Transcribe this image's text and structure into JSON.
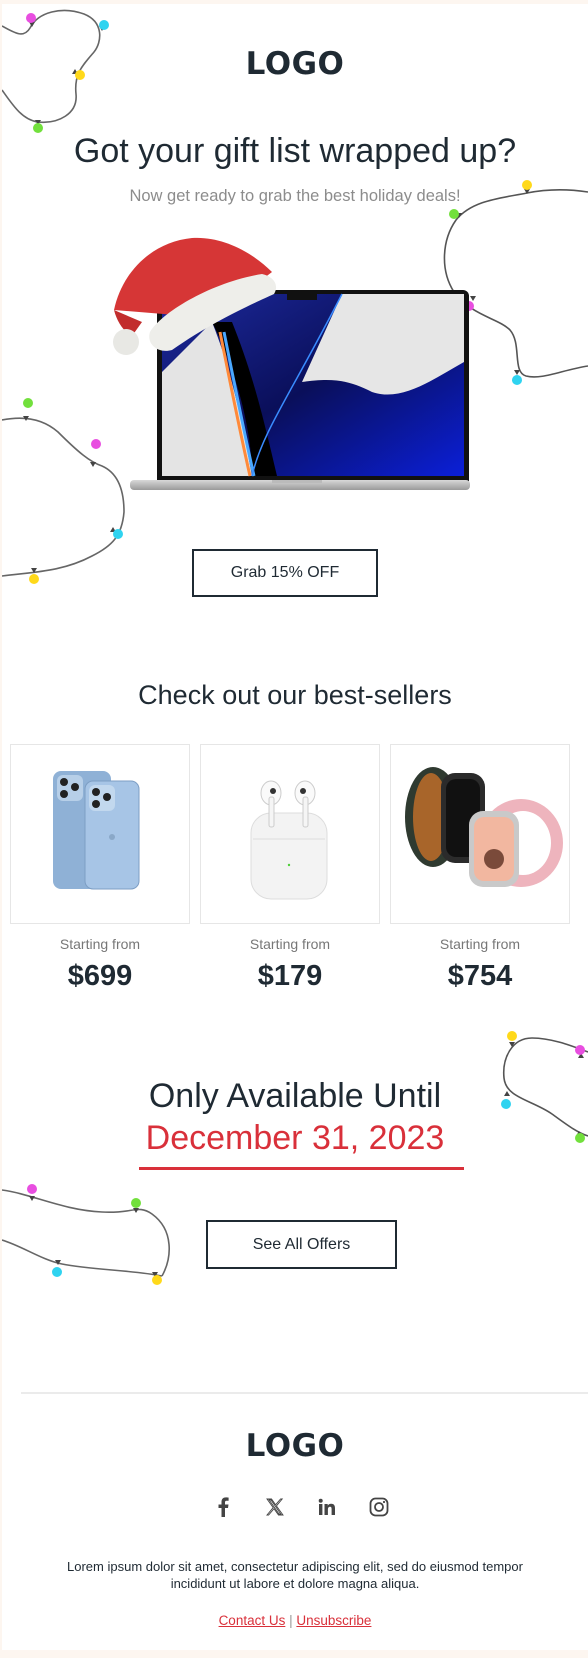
{
  "header": {
    "logo": "LOGO",
    "headline": "Got your gift list wrapped up?",
    "subheadline": "Now get ready to grab the best holiday deals!"
  },
  "hero": {
    "image": "laptop-with-santa-hat",
    "cta_label": "Grab 15% OFF"
  },
  "bestsellers": {
    "title": "Check out our best-sellers",
    "products": [
      {
        "image": "smartphone-blue",
        "caption": "Starting from",
        "price": "$699"
      },
      {
        "image": "wireless-earbuds",
        "caption": "Starting from",
        "price": "$179"
      },
      {
        "image": "smartwatch",
        "caption": "Starting from",
        "price": "$754"
      }
    ]
  },
  "deadline": {
    "line1": "Only Available Until",
    "date": "December 31, 2023",
    "cta_label": "See All Offers"
  },
  "footer": {
    "logo": "LOGO",
    "social": [
      "facebook",
      "x-twitter",
      "linkedin",
      "instagram"
    ],
    "text": "Lorem ipsum dolor sit amet, consectetur adipiscing elit, sed do eiusmod tempor incididunt ut labore et dolore magna aliqua.",
    "contact_label": "Contact Us",
    "separator": "|",
    "unsubscribe_label": "Unsubscribe"
  },
  "colors": {
    "text": "#1f2a33",
    "accent_red": "#d9303a",
    "muted": "#8c8c8c",
    "page_bg": "#fdf6f0",
    "light_pink": "#e84ee0",
    "light_cyan": "#2fd3f0",
    "light_yellow": "#ffd91a",
    "light_green": "#72e03c"
  }
}
